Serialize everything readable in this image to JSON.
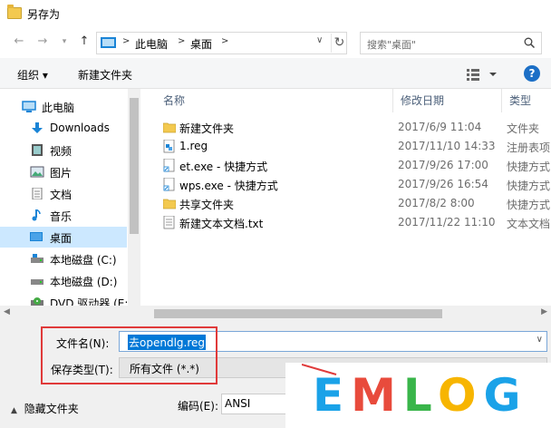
{
  "window": {
    "title": "另存为"
  },
  "nav": {
    "breadcrumb": [
      "此电脑",
      "桌面"
    ],
    "search_placeholder": "搜索\"桌面\""
  },
  "toolbar": {
    "organize": "组织 ▾",
    "new_folder": "新建文件夹"
  },
  "sidebar": {
    "items": [
      {
        "label": "此电脑",
        "icon": "pc-icon"
      },
      {
        "label": "Downloads",
        "icon": "download-icon"
      },
      {
        "label": "视频",
        "icon": "video-icon"
      },
      {
        "label": "图片",
        "icon": "picture-icon"
      },
      {
        "label": "文档",
        "icon": "document-icon"
      },
      {
        "label": "音乐",
        "icon": "music-icon"
      },
      {
        "label": "桌面",
        "icon": "desktop-icon",
        "selected": true
      },
      {
        "label": "本地磁盘 (C:)",
        "icon": "drive-icon"
      },
      {
        "label": "本地磁盘 (D:)",
        "icon": "drive-icon"
      },
      {
        "label": "DVD 驱动器 (E:)",
        "icon": "dvd-icon"
      }
    ]
  },
  "columns": {
    "name": "名称",
    "date": "修改日期",
    "type": "类型"
  },
  "files": [
    {
      "name": "新建文件夹",
      "date": "2017/6/9 11:04",
      "type": "文件夹",
      "icon": "folder-icon"
    },
    {
      "name": "1.reg",
      "date": "2017/11/10 14:33",
      "type": "注册表项",
      "icon": "registry-icon"
    },
    {
      "name": "et.exe - 快捷方式",
      "date": "2017/9/26 17:00",
      "type": "快捷方式",
      "icon": "shortcut-icon"
    },
    {
      "name": "wps.exe - 快捷方式",
      "date": "2017/9/26 16:54",
      "type": "快捷方式",
      "icon": "shortcut-icon"
    },
    {
      "name": "共享文件夹",
      "date": "2017/8/2 8:00",
      "type": "快捷方式",
      "icon": "folder-icon"
    },
    {
      "name": "新建文本文档.txt",
      "date": "2017/11/22 11:10",
      "type": "文本文档",
      "icon": "text-file-icon"
    }
  ],
  "save": {
    "filename_label": "文件名(N):",
    "filename_value": "去opendlg.reg",
    "filetype_label": "保存类型(T):",
    "filetype_value": "所有文件 (*.*)",
    "hide_folders": "隐藏文件夹",
    "encoding_label": "编码(E):",
    "encoding_value": "ANSI"
  },
  "watermark": {
    "text": "EMLOG",
    "colors": [
      "#1aa2e8",
      "#e84b3c",
      "#39b54a",
      "#f7b500",
      "#1aa2e8"
    ]
  },
  "accent": "#0078d7",
  "highlight_color": "#e03a3a"
}
